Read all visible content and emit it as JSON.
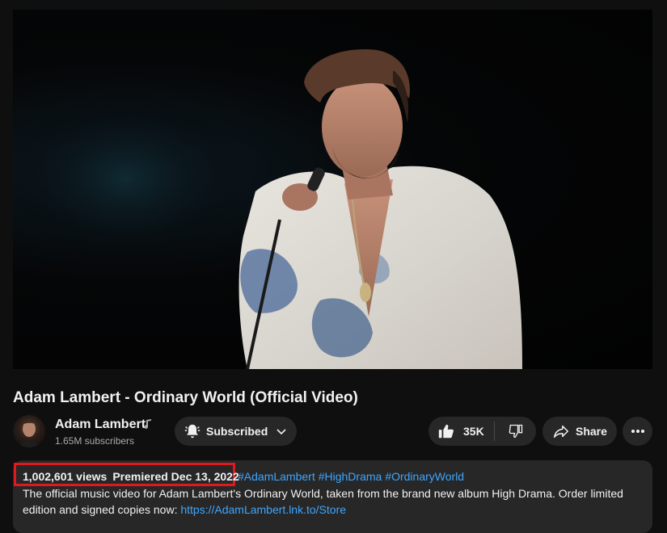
{
  "video": {
    "title": "Adam Lambert - Ordinary World (Official Video)"
  },
  "channel": {
    "name": "Adam Lambert",
    "subscribers": "1.65M subscribers",
    "badge_icon": "music-note-icon"
  },
  "actions": {
    "subscribe_label": "Subscribed",
    "like_count": "35K",
    "share_label": "Share"
  },
  "description": {
    "views": "1,002,601 views",
    "premiered": "Premiered Dec 13, 2022",
    "hashtags": [
      "#AdamLambert",
      "#HighDrama",
      "#OrdinaryWorld"
    ],
    "text": "The official music video for Adam Lambert's Ordinary World, taken from the brand new album High Drama. Order limited edition and signed copies now: ",
    "link": "https://AdamLambert.lnk.to/Store"
  },
  "colors": {
    "background": "#0f0f0f",
    "button": "#272727",
    "link": "#3ea6ff",
    "highlight": "#e0191f"
  }
}
